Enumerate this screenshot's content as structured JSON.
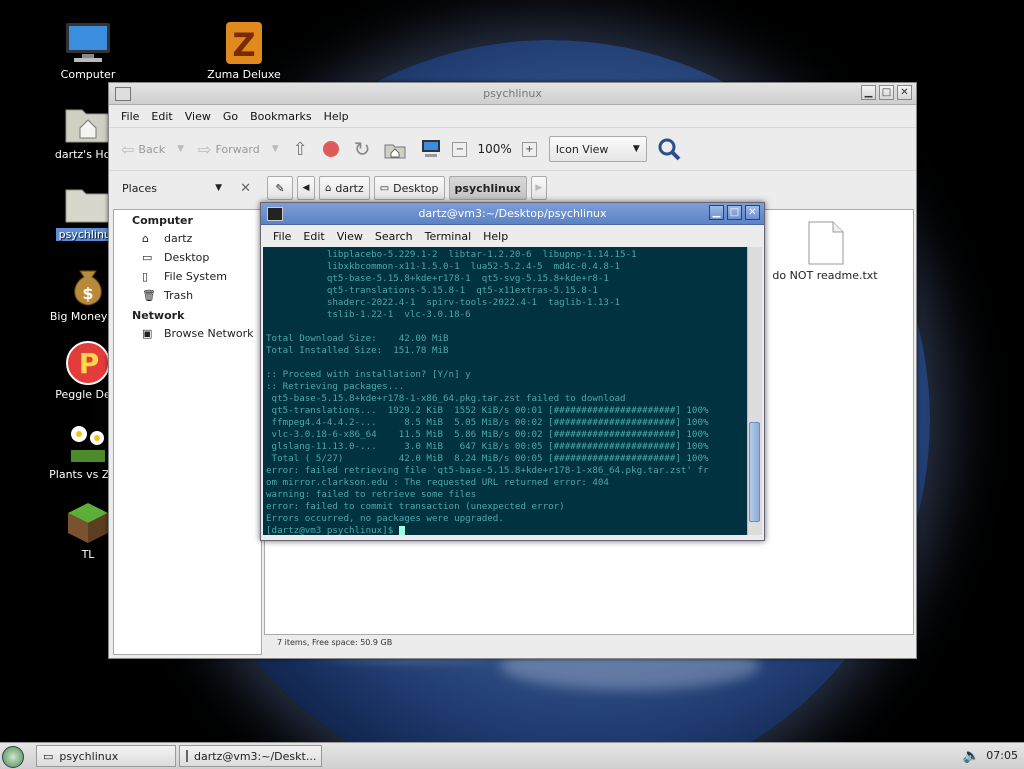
{
  "desktop": {
    "icons": [
      {
        "label": "Computer"
      },
      {
        "label": "Zuma Deluxe"
      },
      {
        "label": "dartz's Hom"
      },
      {
        "label": "psychlinux"
      },
      {
        "label": "Big Money De"
      },
      {
        "label": "Peggle Delu"
      },
      {
        "label": "Plants vs Zom"
      },
      {
        "label": "TL"
      }
    ]
  },
  "filemanager": {
    "title": "psychlinux",
    "menu": [
      "File",
      "Edit",
      "View",
      "Go",
      "Bookmarks",
      "Help"
    ],
    "toolbar": {
      "back": "Back",
      "forward": "Forward",
      "zoom": "100%",
      "view_mode": "Icon View"
    },
    "places_label": "Places",
    "path": [
      "dartz",
      "Desktop",
      "psychlinux"
    ],
    "sidebar": {
      "computer_heading": "Computer",
      "computer_items": [
        "dartz",
        "Desktop",
        "File System",
        "Trash"
      ],
      "network_heading": "Network",
      "network_items": [
        "Browse Network"
      ]
    },
    "files": [
      {
        "name": "do NOT readme.txt"
      }
    ],
    "status": "7 items, Free space: 50.9 GB"
  },
  "terminal": {
    "title": "dartz@vm3:~/Desktop/psychlinux",
    "menu": [
      "File",
      "Edit",
      "View",
      "Search",
      "Terminal",
      "Help"
    ],
    "lines": [
      "           libplacebo-5.229.1-2  libtar-1.2.20-6  libupnp-1.14.15-1",
      "           libxkbcommon-x11-1.5.0-1  lua52-5.2.4-5  md4c-0.4.8-1",
      "           qt5-base-5.15.8+kde+r178-1  qt5-svg-5.15.8+kde+r8-1",
      "           qt5-translations-5.15.8-1  qt5-x11extras-5.15.8-1",
      "           shaderc-2022.4-1  spirv-tools-2022.4-1  taglib-1.13-1",
      "           tslib-1.22-1  vlc-3.0.18-6",
      "",
      "Total Download Size:    42.00 MiB",
      "Total Installed Size:  151.78 MiB",
      "",
      ":: Proceed with installation? [Y/n] y",
      ":: Retrieving packages...",
      " qt5-base-5.15.8+kde+r178-1-x86_64.pkg.tar.zst failed to download",
      " qt5-translations...  1929.2 KiB  1552 KiB/s 00:01 [######################] 100%",
      " ffmpeg4.4-4.4.2-...     8.5 MiB  5.05 MiB/s 00:02 [######################] 100%",
      " vlc-3.0.18-6-x86_64    11.5 MiB  5.86 MiB/s 00:02 [######################] 100%",
      " glslang-11.13.0-...     3.0 MiB   647 KiB/s 00:05 [######################] 100%",
      " Total ( 5/27)          42.0 MiB  8.24 MiB/s 00:05 [######################] 100%",
      "error: failed retrieving file 'qt5-base-5.15.8+kde+r178-1-x86_64.pkg.tar.zst' fr",
      "om mirror.clarkson.edu : The requested URL returned error: 404",
      "warning: failed to retrieve some files",
      "error: failed to commit transaction (unexpected error)",
      "Errors occurred, no packages were upgraded.",
      "[dartz@vm3 psychlinux]$ "
    ]
  },
  "taskbar": {
    "tasks": [
      {
        "label": "psychlinux"
      },
      {
        "label": "dartz@vm3:~/Deskt..."
      }
    ],
    "clock": "07:05"
  }
}
